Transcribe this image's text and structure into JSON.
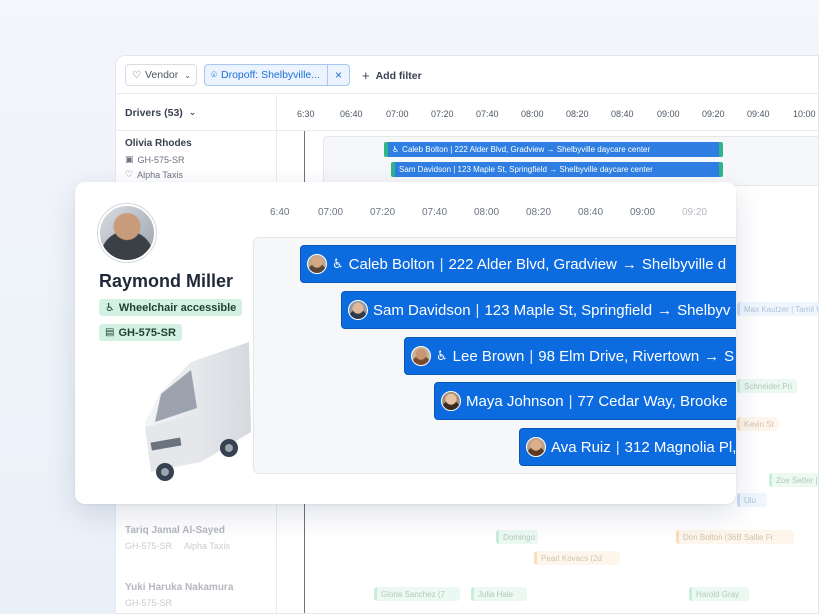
{
  "filterbar": {
    "vendor_label": "Vendor",
    "dropoff_label": "Dropoff: Shelbyville...",
    "clear_symbol": "×",
    "add_filter_label": "Add filter",
    "add_symbol": "+"
  },
  "timeline": {
    "drivers_header": "Drivers (53)",
    "ticks": [
      "6:30",
      "06:40",
      "07:00",
      "07:20",
      "07:40",
      "08:00",
      "08:20",
      "08:40",
      "09:00",
      "09:20",
      "09:40",
      "10:00"
    ]
  },
  "background_driver": {
    "name": "Olivia Rhodes",
    "plate": "GH-575-SR",
    "vendor": "Alpha Taxis"
  },
  "background_trips": [
    "Caleb Bolton | 222 Alder Blvd, Gradview → Shelbyville daycare center",
    "Sam Davidson | 123 Maple St, Springfield → Shelbyville daycare center"
  ],
  "faded_drivers": [
    {
      "name": "Tariq Jamal Al-Sayed",
      "plate": "GH-575-SR",
      "vendor": "Alpha Taxis"
    },
    {
      "name": "Yuki Haruka Nakamura",
      "plate": "GH-575-SR",
      "vendor": ""
    }
  ],
  "faded_pills": [
    "Domingo",
    "Pearl Kovacs (2d",
    "Don Bolton (36B Sallie Fr",
    "Gloria Sanchez (7",
    "Julia Hale",
    "Harold Gray",
    "Max Kautzer | Tamil Wolf",
    "Schneider Pri",
    "Kevin St",
    "Zoe Setter | Sa",
    "Ulu"
  ],
  "card": {
    "driver_name": "Raymond Miller",
    "wheelchair_badge": "Wheelchair accessible",
    "plate_badge": "GH-575-SR",
    "ticks": [
      "6:40",
      "07:00",
      "07:20",
      "07:40",
      "08:00",
      "08:20",
      "08:40",
      "09:00",
      "09:20"
    ],
    "trips": [
      {
        "name": "Caleb Bolton",
        "address": "222 Alder Blvd, Gradview",
        "dest": "Shelbyville d",
        "wheelchair": true
      },
      {
        "name": "Sam Davidson",
        "address": "123 Maple St, Springfield",
        "dest": "Shelbyv",
        "wheelchair": false
      },
      {
        "name": "Lee Brown",
        "address": "98 Elm Drive, Rivertown",
        "dest": "S",
        "wheelchair": true
      },
      {
        "name": "Maya Johnson",
        "address": "77 Cedar Way, Brooke",
        "dest": "",
        "wheelchair": false
      },
      {
        "name": "Ava Ruiz",
        "address": "312 Magnolia Pl,",
        "dest": "",
        "wheelchair": false
      }
    ],
    "arrow": "→",
    "wheelchair_glyph": "♿"
  },
  "colors": {
    "trip_blue": "#0d6be0",
    "badge_green": "#d3f1e3",
    "chip_blue": "#1d6fd8"
  }
}
